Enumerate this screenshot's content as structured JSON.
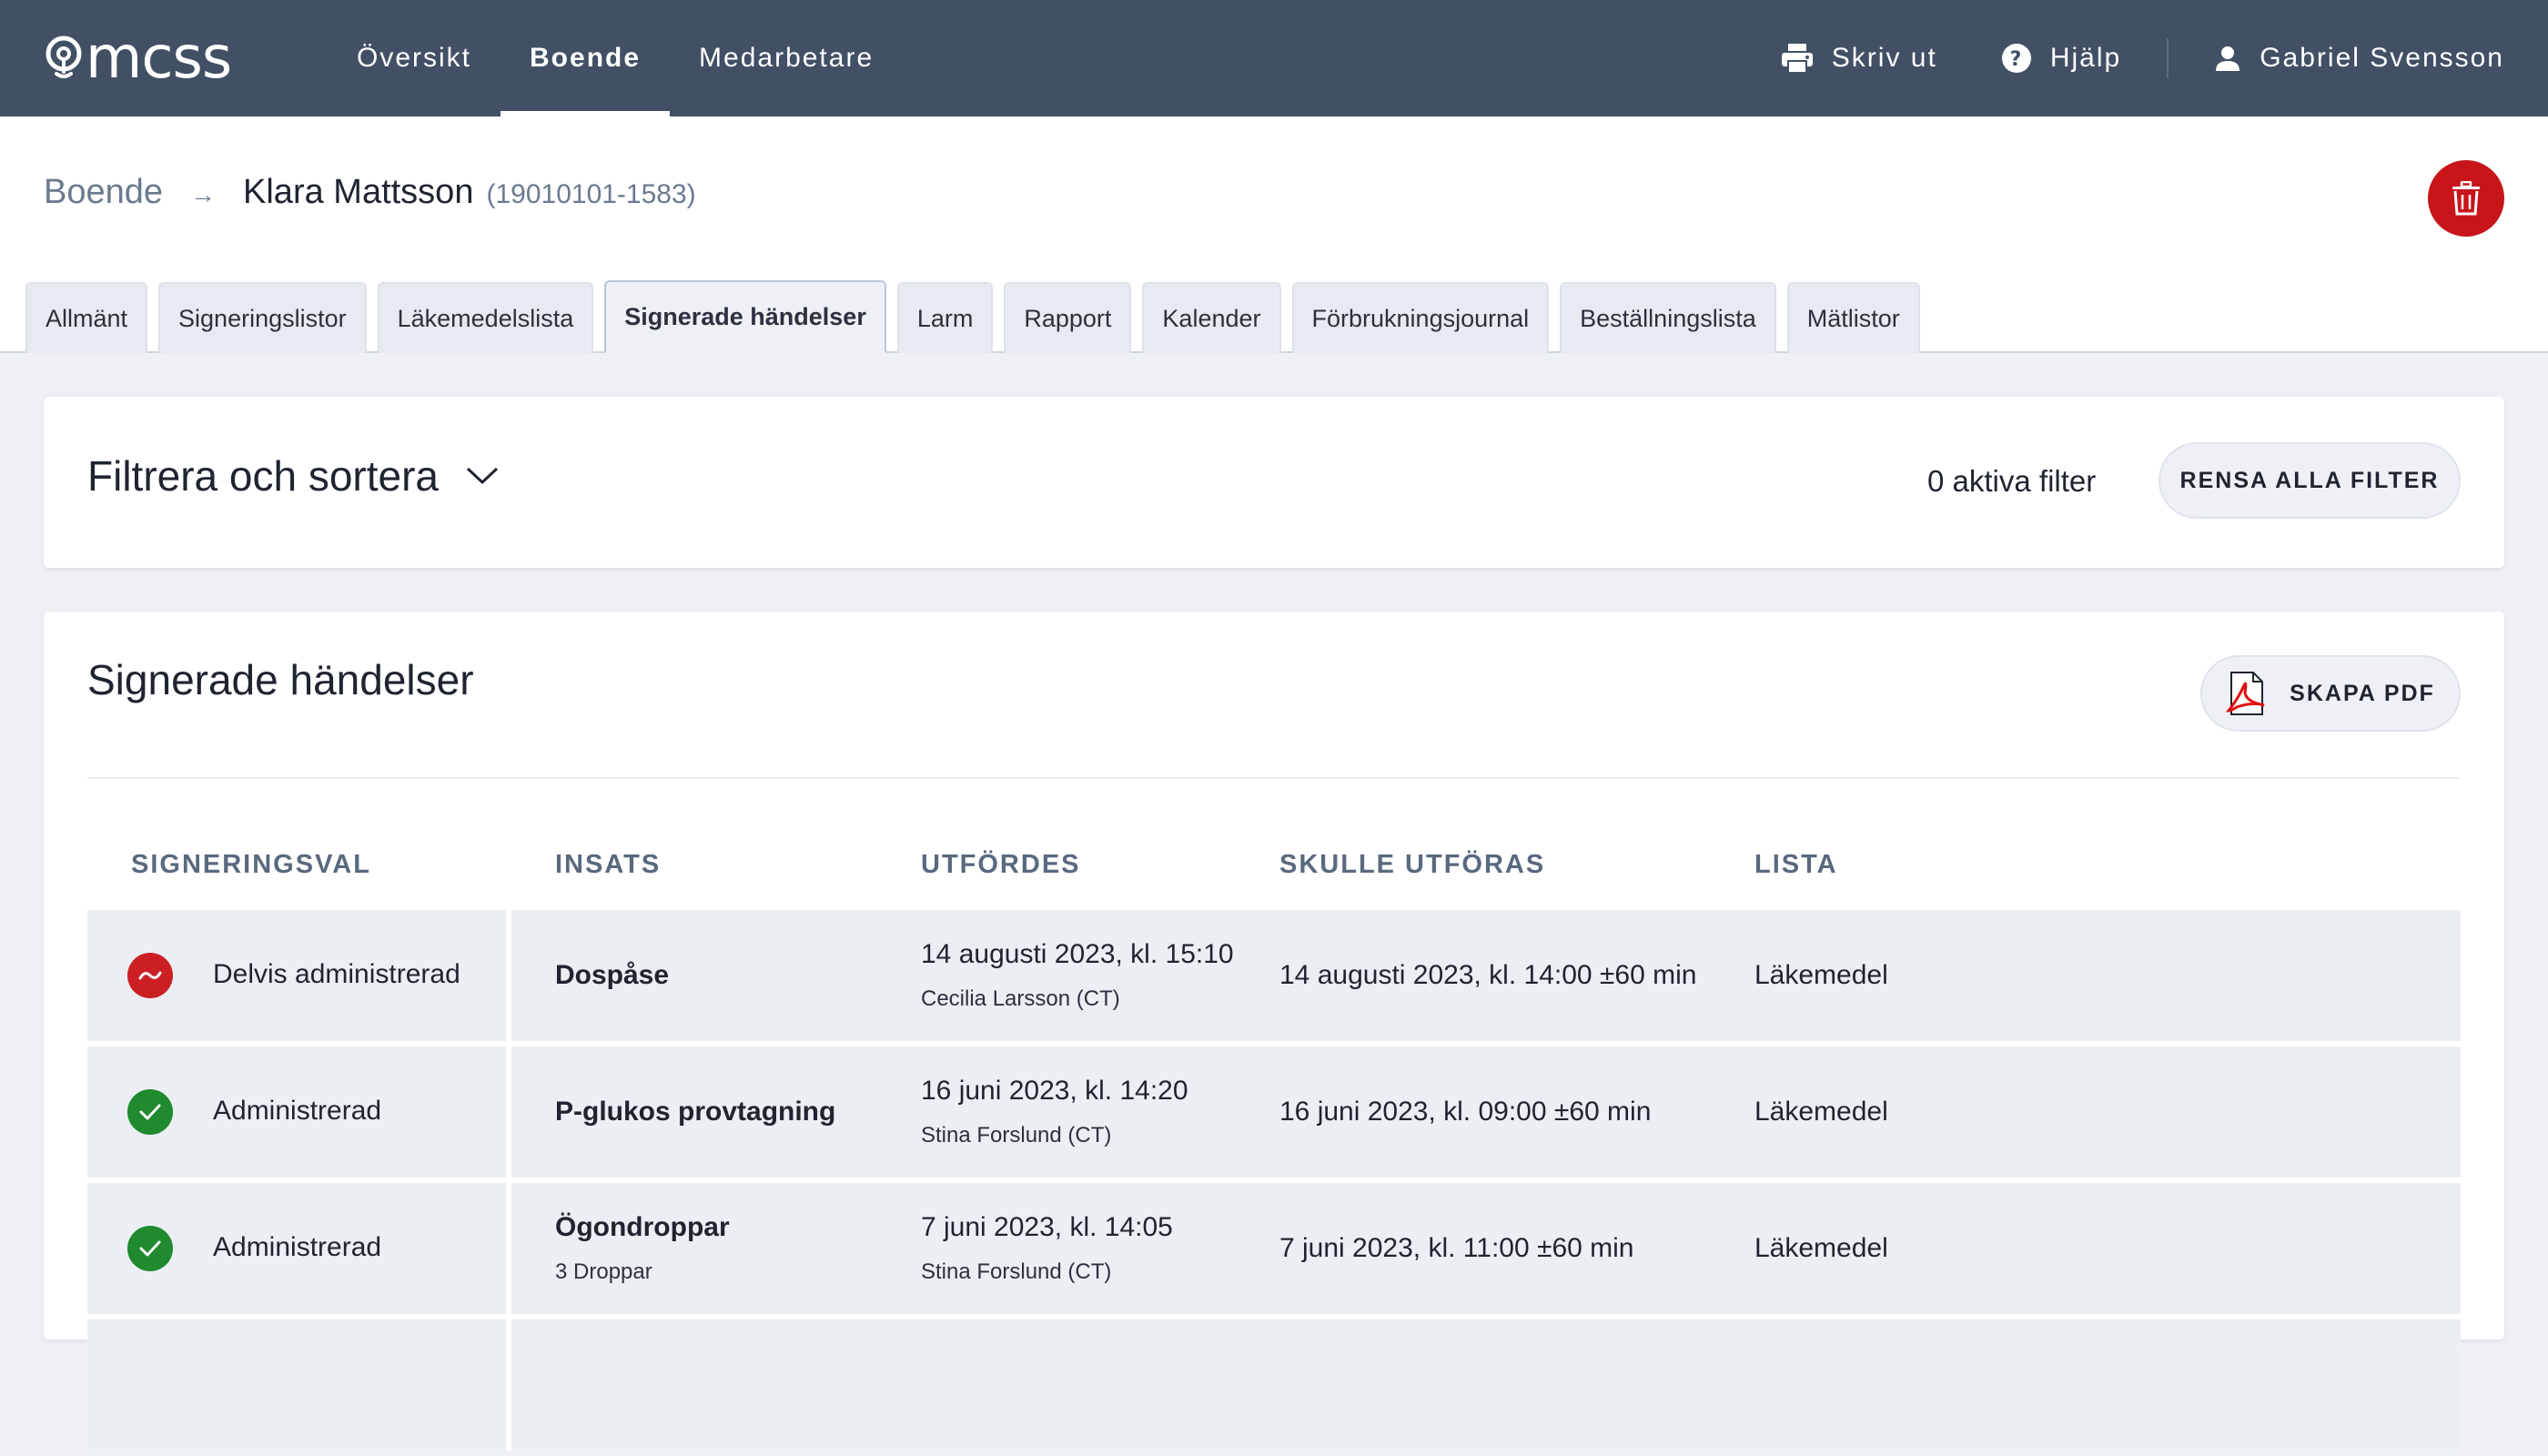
{
  "app": {
    "logo_text": "mcss",
    "nav": [
      {
        "label": "Översikt",
        "active": false
      },
      {
        "label": "Boende",
        "active": true
      },
      {
        "label": "Medarbetare",
        "active": false
      }
    ],
    "print_label": "Skriv ut",
    "help_label": "Hjälp",
    "user_name": "Gabriel Svensson"
  },
  "breadcrumb": {
    "root": "Boende",
    "name": "Klara Mattsson",
    "id": "(19010101-1583)"
  },
  "tabs": [
    {
      "label": "Allmänt",
      "active": false
    },
    {
      "label": "Signeringslistor",
      "active": false
    },
    {
      "label": "Läkemedelslista",
      "active": false
    },
    {
      "label": "Signerade händelser",
      "active": true
    },
    {
      "label": "Larm",
      "active": false
    },
    {
      "label": "Rapport",
      "active": false
    },
    {
      "label": "Kalender",
      "active": false
    },
    {
      "label": "Förbrukningsjournal",
      "active": false
    },
    {
      "label": "Beställningslista",
      "active": false
    },
    {
      "label": "Mätlistor",
      "active": false
    }
  ],
  "filter": {
    "title": "Filtrera och sortera",
    "active_count": "0 aktiva filter",
    "clear_label": "RENSA ALLA FILTER"
  },
  "events": {
    "title": "Signerade händelser",
    "pdf_label": "SKAPA PDF",
    "columns": {
      "status": "SIGNERINGSVAL",
      "action": "INSATS",
      "performed": "UTFÖRDES",
      "scheduled": "SKULLE UTFÖRAS",
      "list": "LISTA"
    },
    "rows": [
      {
        "status": "partial",
        "status_label": "Delvis administrerad",
        "action": "Dospåse",
        "action_sub": "",
        "performed": "14 augusti 2023, kl. 15:10",
        "performed_by": "Cecilia Larsson (CT)",
        "scheduled": "14 augusti 2023, kl. 14:00 ±60 min",
        "list": "Läkemedel"
      },
      {
        "status": "done",
        "status_label": "Administrerad",
        "action": "P-glukos provtagning",
        "action_sub": "",
        "performed": "16 juni 2023, kl. 14:20",
        "performed_by": "Stina Forslund (CT)",
        "scheduled": "16 juni 2023, kl. 09:00 ±60 min",
        "list": "Läkemedel"
      },
      {
        "status": "done",
        "status_label": "Administrerad",
        "action": "Ögondroppar",
        "action_sub": "3 Droppar",
        "performed": "7 juni 2023, kl. 14:05",
        "performed_by": "Stina Forslund (CT)",
        "scheduled": "7 juni 2023, kl. 11:00 ±60 min",
        "list": "Läkemedel"
      }
    ]
  },
  "colors": {
    "topbar": "#425066",
    "danger": "#c8151a",
    "success": "#1f8a2e"
  }
}
